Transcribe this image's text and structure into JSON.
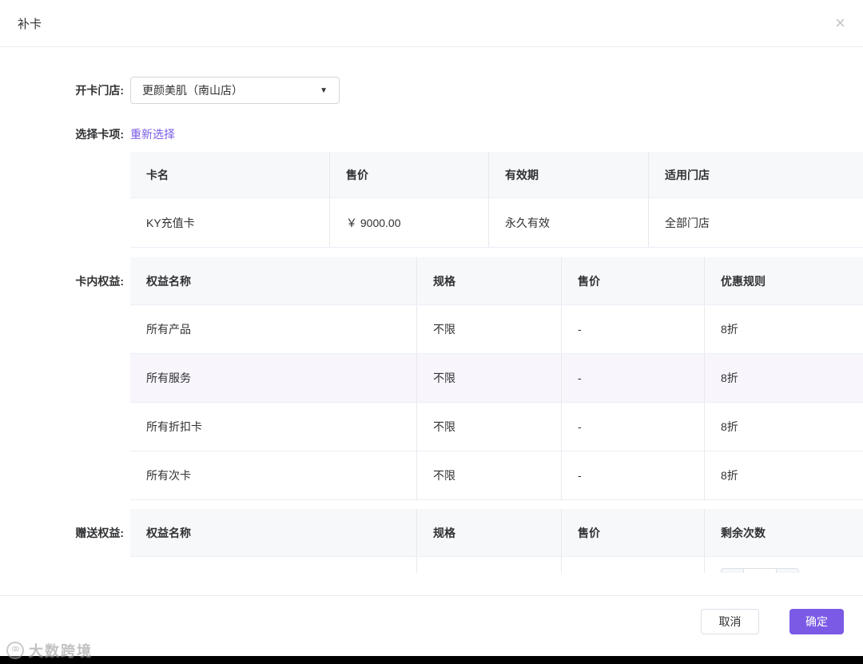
{
  "dialog": {
    "title": "补卡"
  },
  "icons": {
    "close": "×",
    "caret_down": "▼",
    "minus": "−",
    "plus": "+"
  },
  "form": {
    "store_label": "开卡门店:",
    "store_value": "更颜美肌（南山店）",
    "card_label": "选择卡项:",
    "reselect_link": "重新选择",
    "benefits_label": "卡内权益:",
    "gift_label": "赠送权益:"
  },
  "card_table": {
    "headers": [
      "卡名",
      "售价",
      "有效期",
      "适用门店"
    ],
    "row": [
      "KY充值卡",
      "￥ 9000.00",
      "永久有效",
      "全部门店"
    ]
  },
  "benefits_table": {
    "headers": [
      "权益名称",
      "规格",
      "售价",
      "优惠规则"
    ],
    "rows": [
      [
        "所有产品",
        "不限",
        "-",
        "8折"
      ],
      [
        "所有服务",
        "不限",
        "-",
        "8折"
      ],
      [
        "所有折扣卡",
        "不限",
        "-",
        "8折"
      ],
      [
        "所有次卡",
        "不限",
        "-",
        "8折"
      ]
    ]
  },
  "gift_table": {
    "headers": [
      "权益名称",
      "规格",
      "售价",
      "剩余次数"
    ]
  },
  "footer": {
    "cancel": "取消",
    "confirm": "确定"
  },
  "watermark": {
    "text": "大数跨境"
  },
  "colors": {
    "accent": "#7B5BE6",
    "header_bg": "#f7f8fa",
    "row_highlight": "#f8f5fd"
  }
}
